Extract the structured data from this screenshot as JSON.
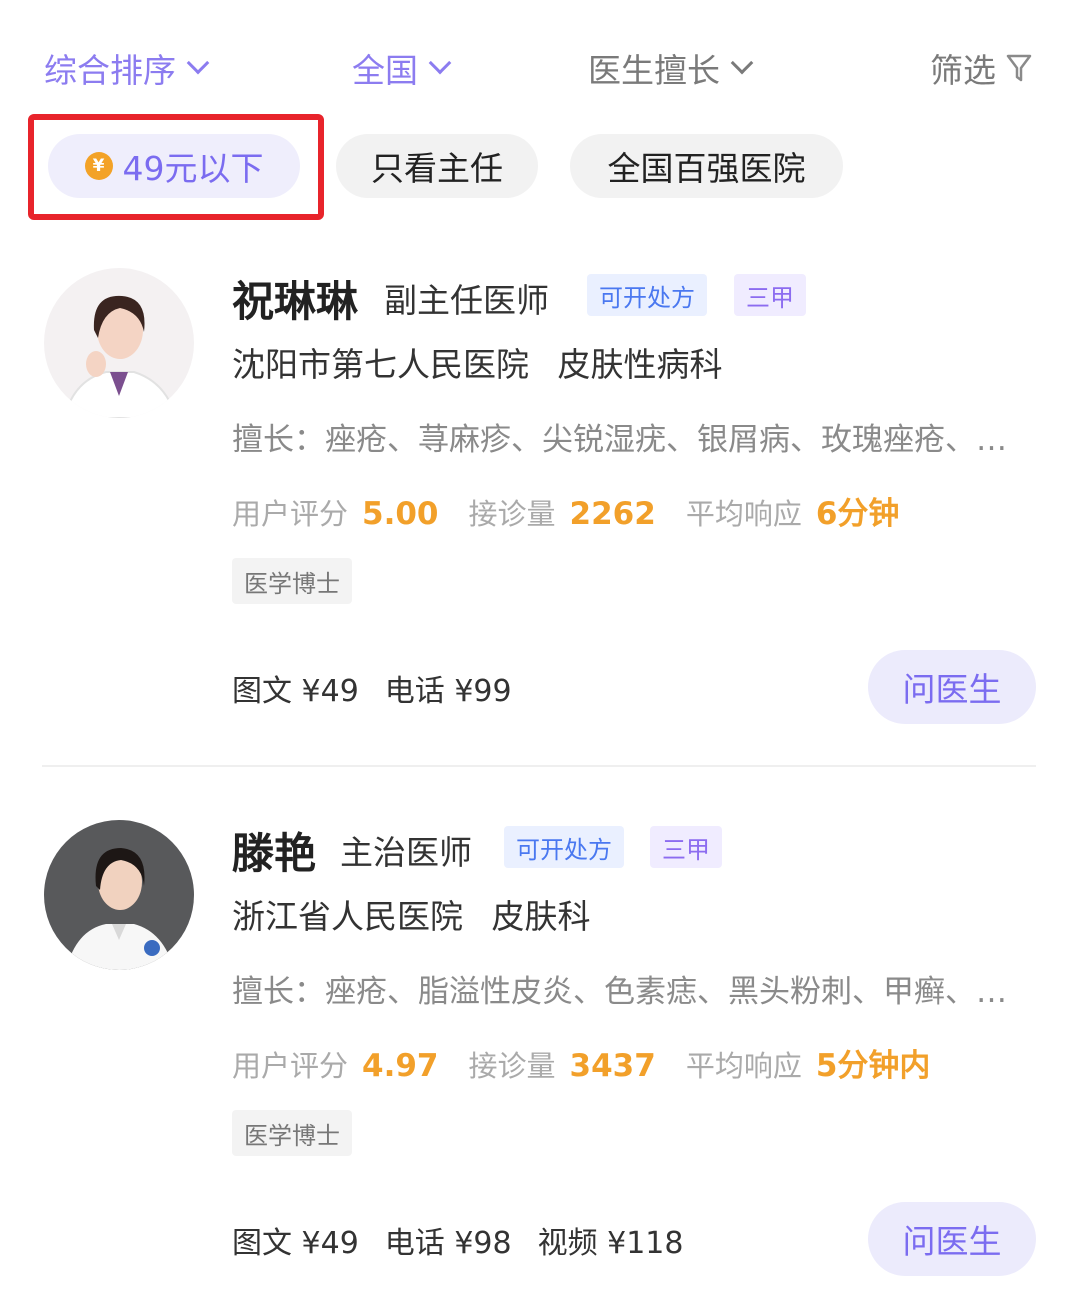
{
  "sort_bar": {
    "sort": "综合排序",
    "region": "全国",
    "specialty": "医生擅长",
    "filter": "筛选"
  },
  "chips": {
    "under_49": "49元以下",
    "coin_symbol": "¥",
    "director_only": "只看主任",
    "top100": "全国百强医院"
  },
  "doctors": [
    {
      "name": "祝琳琳",
      "title": "副主任医师",
      "tag_rx": "可开处方",
      "tag_grade": "三甲",
      "hospital": "沈阳市第七人民医院",
      "department": "皮肤性病科",
      "skills": "擅长：痤疮、荨麻疹、尖锐湿疣、银屑病、玫瑰痤疮、湿疹",
      "rating_label": "用户评分",
      "rating": "5.00",
      "visits_label": "接诊量",
      "visits": "2262",
      "response_label": "平均响应",
      "response": "6分钟",
      "degree": "医学博士",
      "prices": [
        "图文 ¥49",
        "电话 ¥99"
      ],
      "ask": "问医生"
    },
    {
      "name": "滕艳",
      "title": "主治医师",
      "tag_rx": "可开处方",
      "tag_grade": "三甲",
      "hospital": "浙江省人民医院",
      "department": "皮肤科",
      "skills": "擅长：痤疮、脂溢性皮炎、色素痣、黑头粉刺、甲癣、湿疹",
      "rating_label": "用户评分",
      "rating": "4.97",
      "visits_label": "接诊量",
      "visits": "3437",
      "response_label": "平均响应",
      "response": "5分钟内",
      "degree": "医学博士",
      "prices": [
        "图文 ¥49",
        "电话 ¥98",
        "视频 ¥118"
      ],
      "ask": "问医生"
    }
  ]
}
